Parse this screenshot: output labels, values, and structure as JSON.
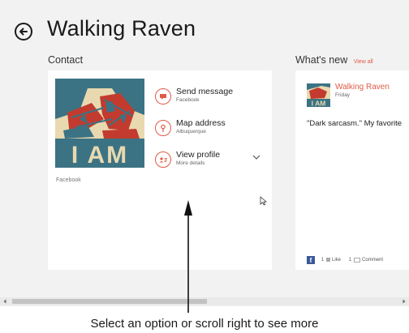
{
  "header": {
    "title": "Walking Raven",
    "back_icon": "back-arrow-circle-icon"
  },
  "contact": {
    "section_label": "Contact",
    "poster_text": "I AM",
    "poster_source": "Facebook",
    "actions": [
      {
        "title": "Send message",
        "subtitle": "Facebook",
        "icon": "message-icon"
      },
      {
        "title": "Map address",
        "subtitle": "Albuquerque",
        "icon": "map-pin-icon"
      },
      {
        "title": "View profile",
        "subtitle": "More details",
        "icon": "profile-card-icon"
      }
    ]
  },
  "whats_new": {
    "section_label": "What's new",
    "view_all": "View all",
    "post": {
      "name": "Walking Raven",
      "day": "Friday",
      "text": "\"Dark sarcasm.\" My favorite",
      "thumb_text": "I AM",
      "likes_count": "1",
      "likes_label": "Like",
      "comments_count": "1",
      "comments_label": "Comment",
      "network_icon": "f"
    }
  },
  "caption": "Select an option or scroll right to see more",
  "colors": {
    "accent": "#e05a47",
    "background": "#f2f2f2",
    "card": "#ffffff",
    "poster_teal": "#3c7384",
    "poster_red": "#c23b2e",
    "poster_cream": "#e8d9b0",
    "facebook_blue": "#3b5998"
  }
}
